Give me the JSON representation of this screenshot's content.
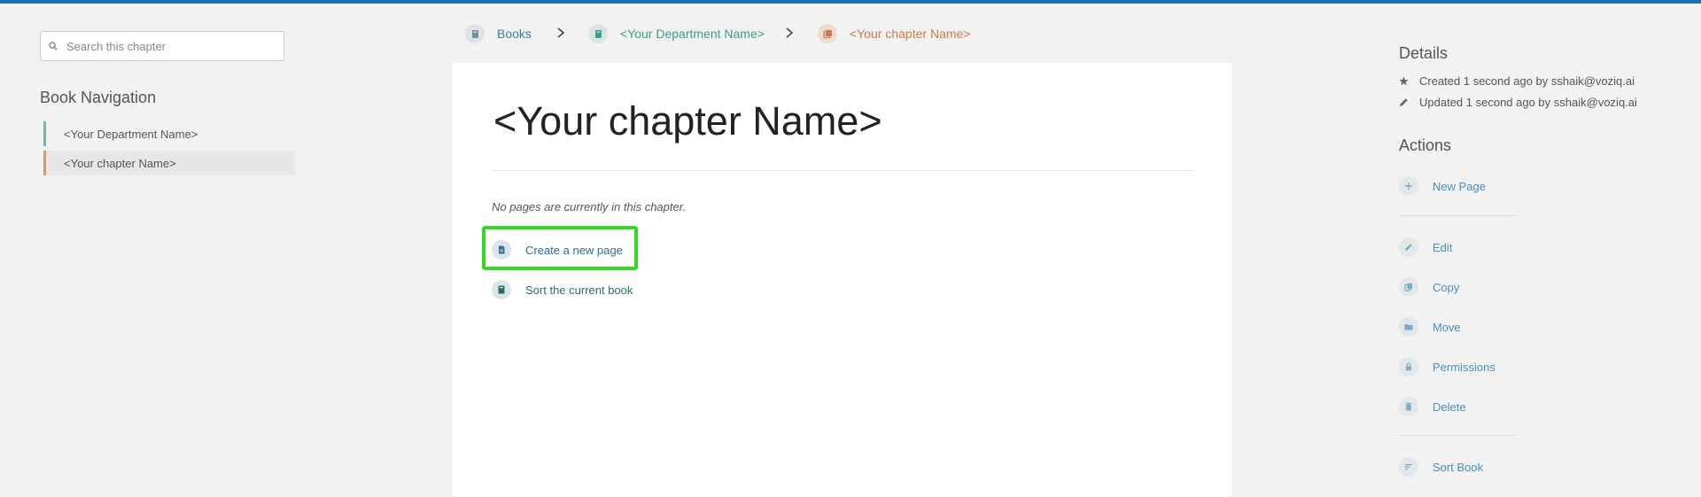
{
  "search": {
    "placeholder": "Search this chapter"
  },
  "book_navigation": {
    "title": "Book Navigation",
    "items": [
      {
        "label": "<Your Department Name>"
      },
      {
        "label": "<Your chapter Name>"
      }
    ]
  },
  "breadcrumb": {
    "books": "Books",
    "department": "<Your Department Name>",
    "chapter": "<Your chapter Name>"
  },
  "main": {
    "title": "<Your chapter Name>",
    "empty_message": "No pages are currently in this chapter.",
    "create_page": "Create a new page",
    "sort_book": "Sort the current book"
  },
  "details": {
    "title": "Details",
    "created": "Created 1 second ago by sshaik@voziq.ai",
    "updated": "Updated 1 second ago by sshaik@voziq.ai"
  },
  "actions": {
    "title": "Actions",
    "new_page": "New Page",
    "edit": "Edit",
    "copy": "Copy",
    "move": "Move",
    "permissions": "Permissions",
    "delete": "Delete",
    "sort_book": "Sort Book"
  },
  "colors": {
    "topbar": "#206ea7",
    "book_accent": "#3d7fa5",
    "department_accent": "#3e9b8a",
    "chapter_accent": "#cc7a4c",
    "annotation_highlight": "#2fdc1f"
  },
  "icons": {
    "search": "search-icon",
    "books": "books-icon",
    "book": "book-icon",
    "chapter": "chapter-icon",
    "page": "page-icon",
    "star": "star-icon",
    "pencil": "pencil-icon",
    "plus": "plus-icon",
    "copy": "copy-icon",
    "folder": "folder-icon",
    "lock": "lock-icon",
    "trash": "trash-icon",
    "sort": "sort-icon"
  }
}
